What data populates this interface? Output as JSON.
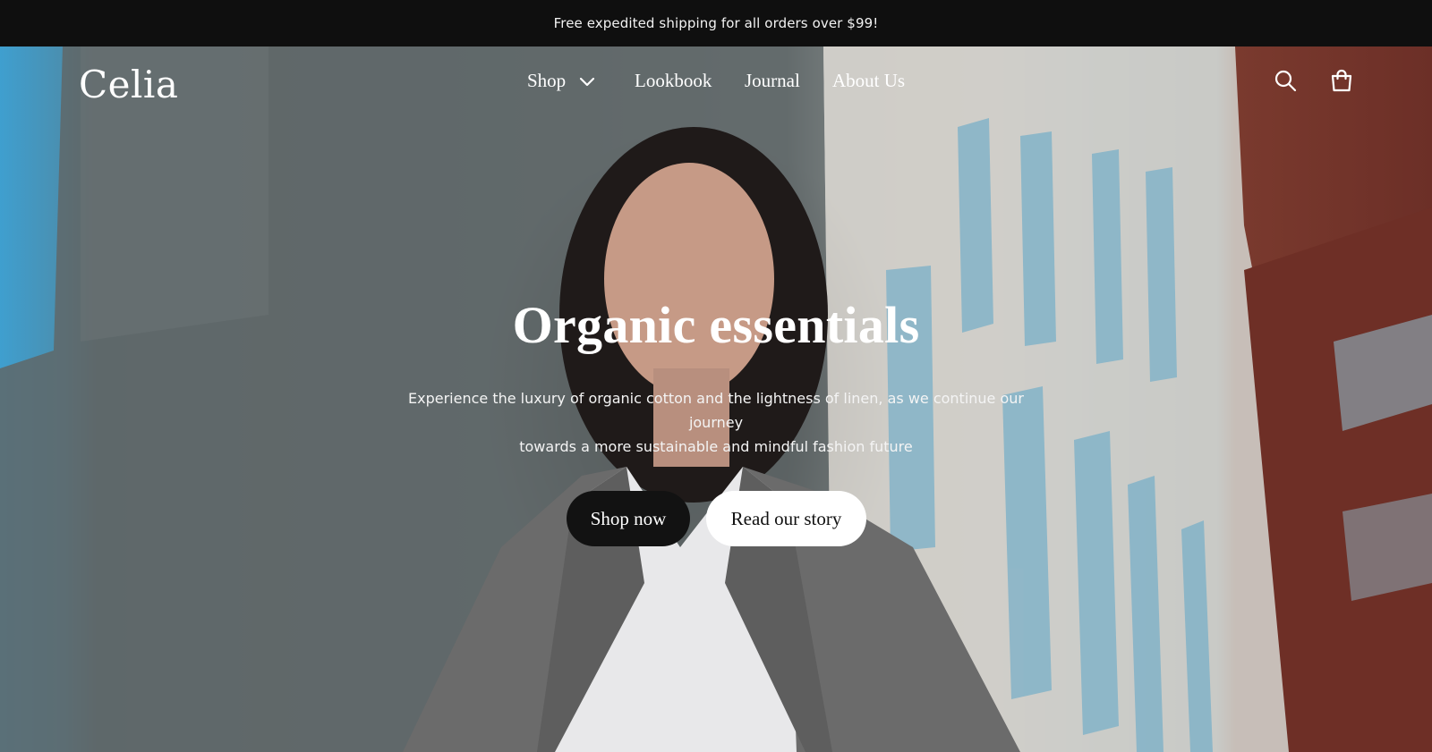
{
  "announcement": {
    "text": "Free expedited shipping for all orders over $99!"
  },
  "header": {
    "brand": "Celia",
    "nav": [
      {
        "label": "Shop",
        "has_dropdown": true
      },
      {
        "label": "Lookbook"
      },
      {
        "label": "Journal"
      },
      {
        "label": "About Us"
      }
    ],
    "icons": [
      "search-icon",
      "shopping-bag-icon"
    ]
  },
  "hero": {
    "title": "Organic essentials",
    "description_line1": "Experience the luxury of organic cotton and the lightness of linen, as we continue our journey",
    "description_line2": "towards a more sustainable and mindful fashion future",
    "primary_cta": "Shop now",
    "secondary_cta": "Read our story"
  },
  "colors": {
    "announcement_bg": "#0f0f0f",
    "primary_button_bg": "#121212",
    "secondary_button_bg": "#ffffff",
    "text_light": "#ffffff"
  }
}
